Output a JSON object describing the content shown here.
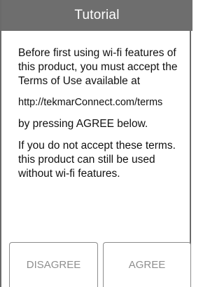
{
  "dialog": {
    "title": "Tutorial",
    "paragraphs": [
      "Before first using wi-fi features of this product, you must accept the Terms of Use available at",
      "http://tekmarConnect.com/terms",
      "by pressing AGREE below.",
      "If you do not accept these terms. this product can still be used without wi-fi features."
    ],
    "buttons": {
      "disagree": "DISAGREE",
      "agree": "AGREE"
    }
  },
  "colors": {
    "title_bar": "#6e6e6e",
    "title_text": "#ffffff",
    "body_text": "#111111",
    "button_text": "#8f8f8f"
  }
}
